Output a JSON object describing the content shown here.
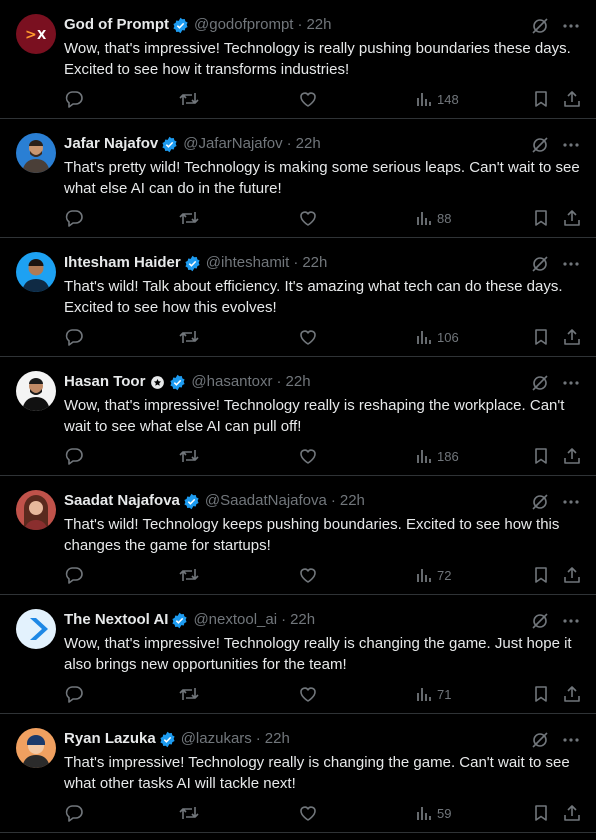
{
  "tweets": [
    {
      "name": "God of Prompt",
      "handle": "@godofprompt",
      "time": "22h",
      "text": "Wow, that's impressive! Technology is really pushing boundaries these days. Excited to see how it transforms industries!",
      "views": "148",
      "avatar": "god-of-prompt-logo",
      "avatar_bg": "#7a1020"
    },
    {
      "name": "Jafar Najafov",
      "handle": "@JafarNajafov",
      "time": "22h",
      "text": "That's pretty wild! Technology is making some serious leaps. Can't wait to see what else AI can do in the future!",
      "views": "88",
      "avatar": "person-photo",
      "avatar_bg": "#2a7fd4"
    },
    {
      "name": "Ihtesham Haider",
      "handle": "@ihteshamit",
      "time": "22h",
      "text": "That's wild! Talk about efficiency. It's amazing what tech can do these days. Excited to see how this evolves!",
      "views": "106",
      "avatar": "person-photo",
      "avatar_bg": "#1da1f2"
    },
    {
      "name": "Hasan Toor",
      "handle": "@hasantoxr",
      "time": "22h",
      "text": "Wow, that's impressive! Technology really is reshaping the workplace. Can't wait to see what else AI can pull off!",
      "views": "186",
      "avatar": "person-photo",
      "avatar_bg": "#f4f4f4"
    },
    {
      "name": "Saadat Najafova",
      "handle": "@SaadatNajafova",
      "time": "22h",
      "text": "That's wild! Technology keeps pushing boundaries. Excited to see how this changes the game for startups!",
      "views": "72",
      "avatar": "person-photo",
      "avatar_bg": "#c0524a"
    },
    {
      "name": "The Nextool AI",
      "handle": "@nextool_ai",
      "time": "22h",
      "text": "Wow, that's impressive! Technology really is changing the game. Just hope it also brings new opportunities for the team!",
      "views": "71",
      "avatar": "nextool-chevron-logo",
      "avatar_bg": "#1e88e5"
    },
    {
      "name": "Ryan Lazuka",
      "handle": "@lazukars",
      "time": "22h",
      "text": "That's impressive! Technology really is changing the game. Can't wait to see what other tasks AI will tackle next!",
      "views": "59",
      "avatar": "person-photo",
      "avatar_bg": "#f0a060"
    }
  ],
  "colors": {
    "background": "#000000",
    "text": "#e7e9ea",
    "muted": "#71767b",
    "verified": "#1d9bf0",
    "divider": "#2f3336"
  },
  "icons": [
    "verified-badge-icon",
    "grok-icon",
    "more-icon",
    "reply-icon",
    "retweet-icon",
    "like-icon",
    "views-icon",
    "bookmark-icon",
    "share-icon"
  ]
}
